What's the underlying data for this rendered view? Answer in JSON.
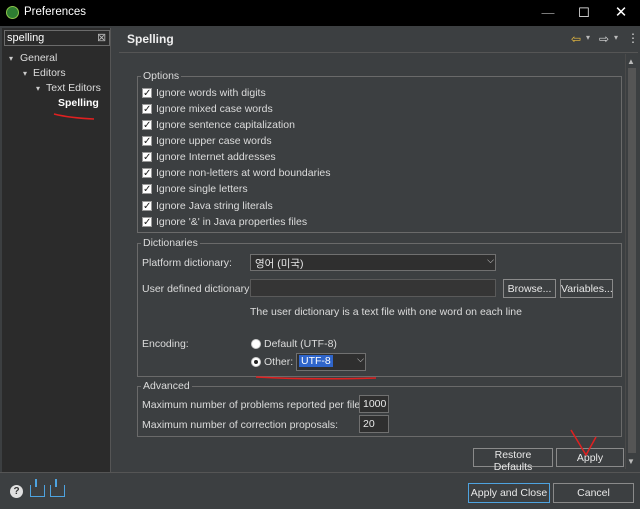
{
  "window": {
    "title": "Preferences"
  },
  "sidebar": {
    "filter_value": "spelling",
    "items": [
      {
        "label": "General"
      },
      {
        "label": "Editors"
      },
      {
        "label": "Text Editors"
      },
      {
        "label": "Spelling"
      }
    ]
  },
  "page": {
    "title": "Spelling"
  },
  "options": {
    "legend": "Options",
    "items": [
      {
        "label": "Ignore words with digits",
        "checked": true
      },
      {
        "label": "Ignore mixed case words",
        "checked": true
      },
      {
        "label": "Ignore sentence capitalization",
        "checked": true
      },
      {
        "label": "Ignore upper case words",
        "checked": true
      },
      {
        "label": "Ignore Internet addresses",
        "checked": true
      },
      {
        "label": "Ignore non-letters at word boundaries",
        "checked": true
      },
      {
        "label": "Ignore single letters",
        "checked": true
      },
      {
        "label": "Ignore Java string literals",
        "checked": true
      },
      {
        "label": "Ignore '&' in Java properties files",
        "checked": true
      }
    ]
  },
  "dictionaries": {
    "legend": "Dictionaries",
    "platform_label": "Platform dictionary:",
    "platform_value": "영어 (미국)",
    "user_label": "User defined dictionary:",
    "user_value": "",
    "browse_label": "Browse...",
    "variables_label": "Variables...",
    "hint": "The user dictionary is a text file with one word on each line",
    "encoding_label": "Encoding:",
    "default_label": "Default (UTF-8)",
    "other_label": "Other:",
    "other_value": "UTF-8",
    "selected": "other"
  },
  "advanced": {
    "legend": "Advanced",
    "max_problems_label": "Maximum number of problems reported per file:",
    "max_problems_value": "1000",
    "max_proposals_label": "Maximum number of correction proposals:",
    "max_proposals_value": "20"
  },
  "buttons": {
    "restore_defaults": "Restore Defaults",
    "apply": "Apply",
    "apply_and_close": "Apply and Close",
    "cancel": "Cancel"
  },
  "icons": {
    "help": "help-icon",
    "import": "import-icon",
    "export": "export-icon"
  },
  "colors": {
    "background": "#3c3f41",
    "annotation": "#e02020",
    "selection": "#2f65ca"
  }
}
